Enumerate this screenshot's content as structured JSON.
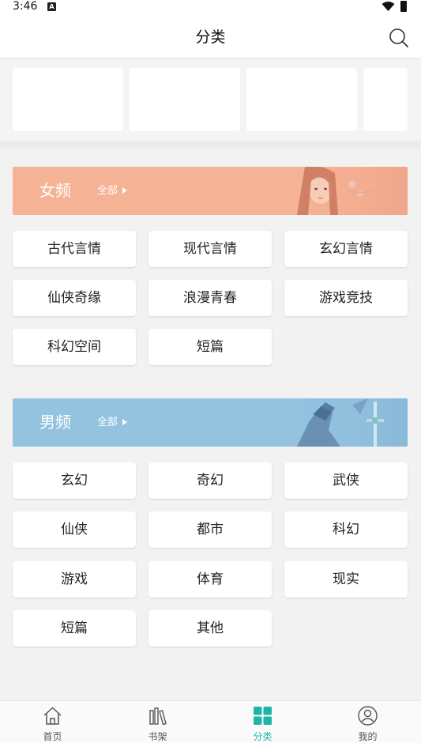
{
  "status": {
    "time": "3:46",
    "notif_letter": "A"
  },
  "header": {
    "title": "分类"
  },
  "female": {
    "title": "女频",
    "all_label": "全部",
    "tags": [
      "古代言情",
      "现代言情",
      "玄幻言情",
      "仙侠奇缘",
      "浪漫青春",
      "游戏竞技",
      "科幻空间",
      "短篇"
    ]
  },
  "male": {
    "title": "男频",
    "all_label": "全部",
    "tags": [
      "玄幻",
      "奇幻",
      "武侠",
      "仙侠",
      "都市",
      "科幻",
      "游戏",
      "体育",
      "现实",
      "短篇",
      "其他"
    ]
  },
  "tabs": [
    {
      "label": "首页",
      "icon": "home-icon"
    },
    {
      "label": "书架",
      "icon": "bookshelf-icon"
    },
    {
      "label": "分类",
      "icon": "category-icon",
      "active": true
    },
    {
      "label": "我的",
      "icon": "profile-icon"
    }
  ],
  "colors": {
    "female_banner": "#f5b294",
    "male_banner": "#94c3e0",
    "accent": "#1fb5a6"
  }
}
